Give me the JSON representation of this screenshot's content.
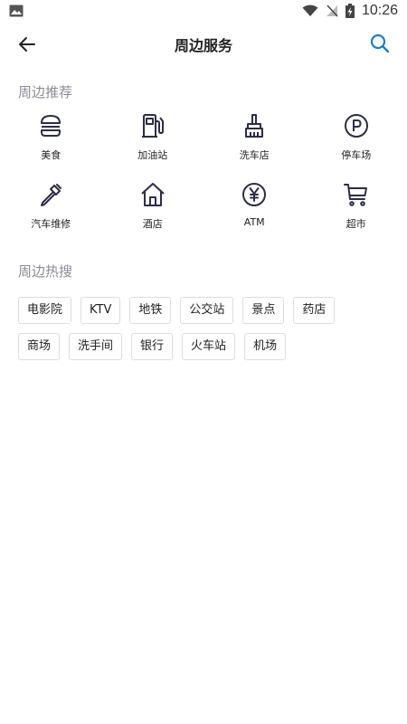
{
  "statusbar": {
    "time": "10:26"
  },
  "navbar": {
    "title": "周边服务"
  },
  "recommend": {
    "title": "周边推荐",
    "items": [
      {
        "label": "美食",
        "icon": "burger-icon"
      },
      {
        "label": "加油站",
        "icon": "gas-pump-icon"
      },
      {
        "label": "洗车店",
        "icon": "brush-icon"
      },
      {
        "label": "停车场",
        "icon": "parking-icon"
      },
      {
        "label": "汽车维修",
        "icon": "screwdriver-icon"
      },
      {
        "label": "酒店",
        "icon": "house-icon"
      },
      {
        "label": "ATM",
        "icon": "yen-icon"
      },
      {
        "label": "超市",
        "icon": "cart-icon"
      }
    ]
  },
  "hot": {
    "title": "周边热搜",
    "tags": [
      "电影院",
      "KTV",
      "地铁",
      "公交站",
      "景点",
      "药店",
      "商场",
      "洗手间",
      "银行",
      "火车站",
      "机场"
    ]
  },
  "colors": {
    "icon": "#2c2c4a",
    "accent": "#1a7fd1",
    "section": "#8a8a99",
    "border": "#dcdce2"
  }
}
